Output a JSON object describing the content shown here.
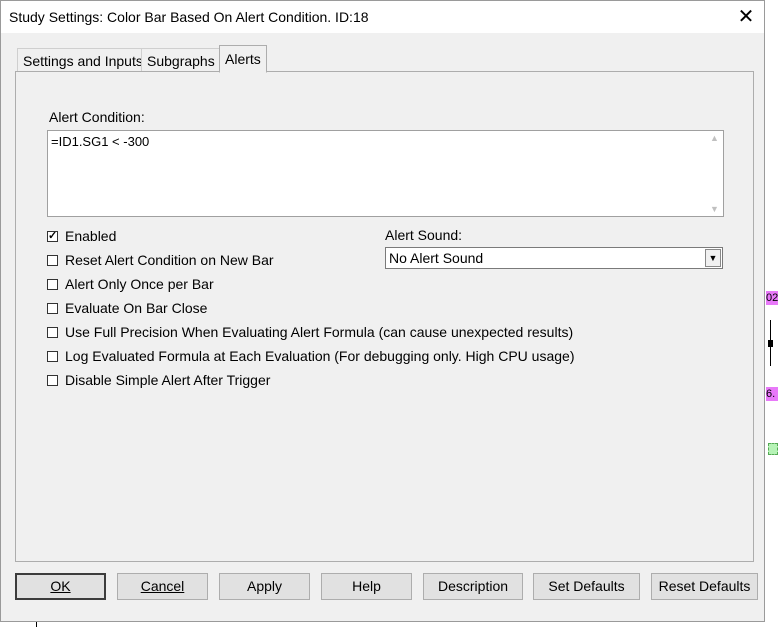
{
  "window": {
    "title": "Study Settings: Color Bar Based On Alert Condition. ID:18",
    "close_glyph": "✕"
  },
  "tabs": [
    {
      "label": "Settings and Inputs",
      "active": false
    },
    {
      "label": "Subgraphs",
      "active": false
    },
    {
      "label": "Alerts",
      "active": true
    }
  ],
  "alert_condition": {
    "label": "Alert Condition:",
    "value": "=ID1.SG1 < -300"
  },
  "checkboxes": [
    {
      "label": "Enabled",
      "checked": true
    },
    {
      "label": "Reset Alert Condition on New Bar",
      "checked": false
    },
    {
      "label": "Alert Only Once per Bar",
      "checked": false
    },
    {
      "label": "Evaluate On Bar Close",
      "checked": false
    },
    {
      "label": "Use Full Precision When Evaluating Alert Formula (can cause unexpected results)",
      "checked": false
    },
    {
      "label": "Log Evaluated Formula at Each Evaluation (For debugging only. High CPU usage)",
      "checked": false
    },
    {
      "label": "Disable Simple Alert After Trigger",
      "checked": false
    }
  ],
  "alert_sound": {
    "label": "Alert Sound:",
    "selected": "No Alert Sound"
  },
  "buttons": {
    "ok": "OK",
    "cancel": "Cancel",
    "apply": "Apply",
    "help": "Help",
    "description": "Description",
    "set_defaults": "Set Defaults",
    "reset_defaults": "Reset Defaults"
  },
  "background_fragments": {
    "frag_a": "02",
    "frag_b": "6."
  },
  "colors": {
    "dialog_bg": "#f0f0f0",
    "magenta_fragment": "#e879f9",
    "green_fragment": "#b6f3b6"
  }
}
